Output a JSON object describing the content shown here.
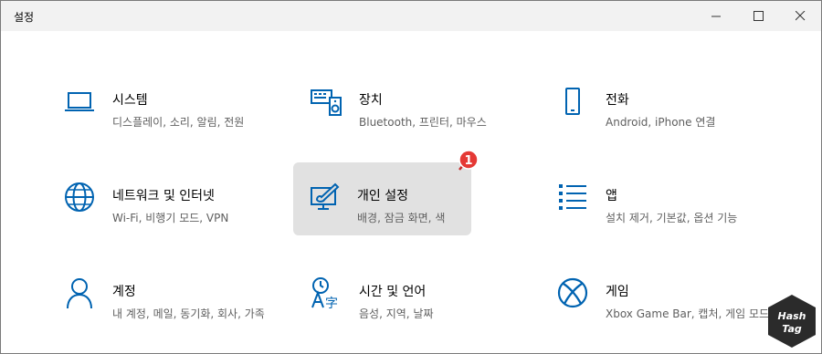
{
  "window": {
    "title": "설정"
  },
  "tiles": [
    {
      "name": "시스템",
      "desc": "디스플레이, 소리, 알림, 전원"
    },
    {
      "name": "장치",
      "desc": "Bluetooth, 프린터, 마우스"
    },
    {
      "name": "전화",
      "desc": "Android, iPhone 연결"
    },
    {
      "name": "네트워크 및 인터넷",
      "desc": "Wi-Fi, 비행기 모드, VPN"
    },
    {
      "name": "개인 설정",
      "desc": "배경, 잠금 화면, 색"
    },
    {
      "name": "앱",
      "desc": "설치 제거, 기본값, 옵션 기능"
    },
    {
      "name": "계정",
      "desc": "내 계정, 메일, 동기화, 회사, 가족"
    },
    {
      "name": "시간 및 언어",
      "desc": "음성, 지역, 날짜"
    },
    {
      "name": "게임",
      "desc": "Xbox Game Bar, 캡처, 게임 모드"
    }
  ],
  "annotation": {
    "badge": "1"
  },
  "watermark": {
    "line1": "Hash",
    "line2": "Tag"
  },
  "colors": {
    "icon": "#0063b1",
    "hover_bg": "#e1e1e1",
    "badge": "#e53935"
  },
  "icons": [
    "laptop-icon",
    "keyboard-speaker-icon",
    "phone-icon",
    "globe-icon",
    "paint-brush-icon",
    "apps-list-icon",
    "person-icon",
    "language-icon",
    "xbox-icon"
  ]
}
